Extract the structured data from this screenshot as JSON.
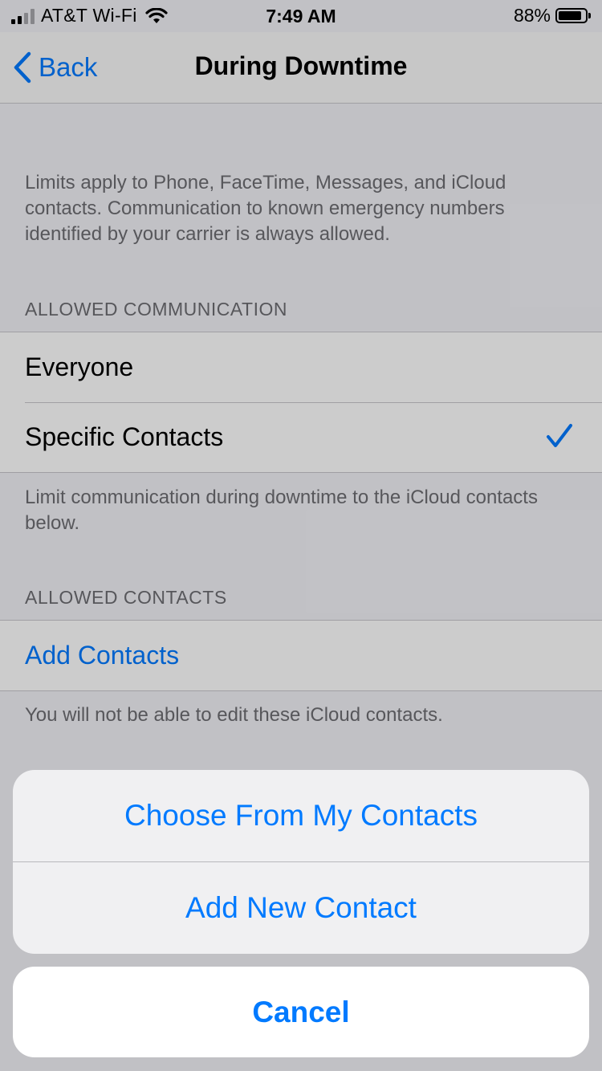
{
  "status_bar": {
    "carrier": "AT&T Wi-Fi",
    "time": "7:49 AM",
    "battery_percent": "88%",
    "battery_level": 0.88
  },
  "nav": {
    "back_label": "Back",
    "title": "During Downtime"
  },
  "intro_text": "Limits apply to Phone, FaceTime, Messages, and iCloud contacts. Communication to known emergency numbers identified by your carrier is always allowed.",
  "allowed_communication": {
    "header": "ALLOWED COMMUNICATION",
    "options": [
      {
        "label": "Everyone",
        "selected": false
      },
      {
        "label": "Specific Contacts",
        "selected": true
      }
    ],
    "footer": "Limit communication during downtime to the iCloud contacts below."
  },
  "allowed_contacts": {
    "header": "ALLOWED CONTACTS",
    "add_label": "Add Contacts",
    "footer": "You will not be able to edit these iCloud contacts."
  },
  "action_sheet": {
    "actions": [
      "Choose From My Contacts",
      "Add New Contact"
    ],
    "cancel": "Cancel"
  },
  "colors": {
    "accent": "#007aff",
    "secondary_text": "#6d6d72",
    "background": "#f2f2f7"
  }
}
